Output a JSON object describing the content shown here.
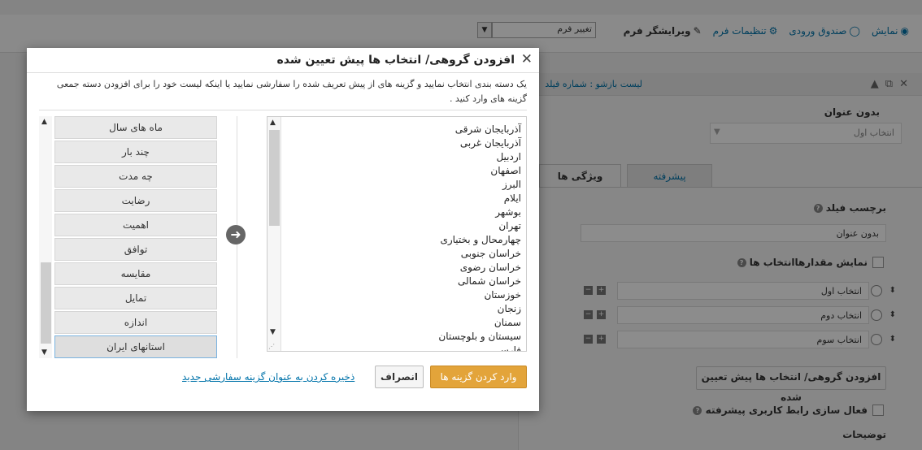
{
  "topbar": {
    "nav": [
      {
        "label": "ویرایشگر فرم",
        "icon": "edit-icon"
      },
      {
        "label": "تنظیمات فرم",
        "icon": "gear-icon"
      },
      {
        "label": "صندوق ورودی",
        "icon": "chat-icon"
      },
      {
        "label": "نمایش",
        "icon": "eye-icon"
      }
    ],
    "form_select_value": "تغییر فرم"
  },
  "panel": {
    "header_title": "لیست بازشو : شماره فیلد",
    "field_name": "بدون عنوان",
    "dropdown_value": "انتخاب اول",
    "tabs": {
      "advanced": "پیشرفته",
      "properties": "ویژگی ها"
    },
    "field_label_title": "برچسب فیلد",
    "field_label_value": "بدون عنوان",
    "show_values_label": "نمایش مقدارهاانتخاب ها",
    "options": [
      "انتخاب اول",
      "انتخاب دوم",
      "انتخاب سوم"
    ],
    "bulk_button": "افزودن گروهی/ انتخاب ها پیش تعیین شده",
    "advanced_ui_label": "فعال سازی رابط کاربری پیشرفته",
    "description_label": "توضیحات"
  },
  "modal": {
    "title": "افزودن گروهی/ انتخاب ها پیش تعیین شده",
    "description": "یک دسته بندی انتخاب نمایید و گزینه های از پیش تعریف شده را سفارشی نمایید یا اینکه لیست خود را برای افزودن دسته جمعی گزینه های وارد کنید .",
    "preview_items": [
      "آذربایجان شرقی",
      "آذربایجان غربی",
      "اردبیل",
      "اصفهان",
      "البرز",
      "ایلام",
      "بوشهر",
      "تهران",
      "چهارمحال و بختیاری",
      "خراسان جنوبی",
      "خراسان رضوی",
      "خراسان شمالی",
      "خوزستان",
      "زنجان",
      "سمنان",
      "سیستان و بلوچستان",
      "فارس"
    ],
    "categories": [
      "ماه های سال",
      "چند بار",
      "چه مدت",
      "رضایت",
      "اهمیت",
      "توافق",
      "مقایسه",
      "تمایل",
      "اندازه",
      "استانهای ایران"
    ],
    "selected_category": "استانهای ایران",
    "insert_button": "وارد کردن گزینه ها",
    "cancel_button": "انصراف",
    "save_link": "ذخیره کردن به عنوان گزینه سفارشی جدید"
  }
}
